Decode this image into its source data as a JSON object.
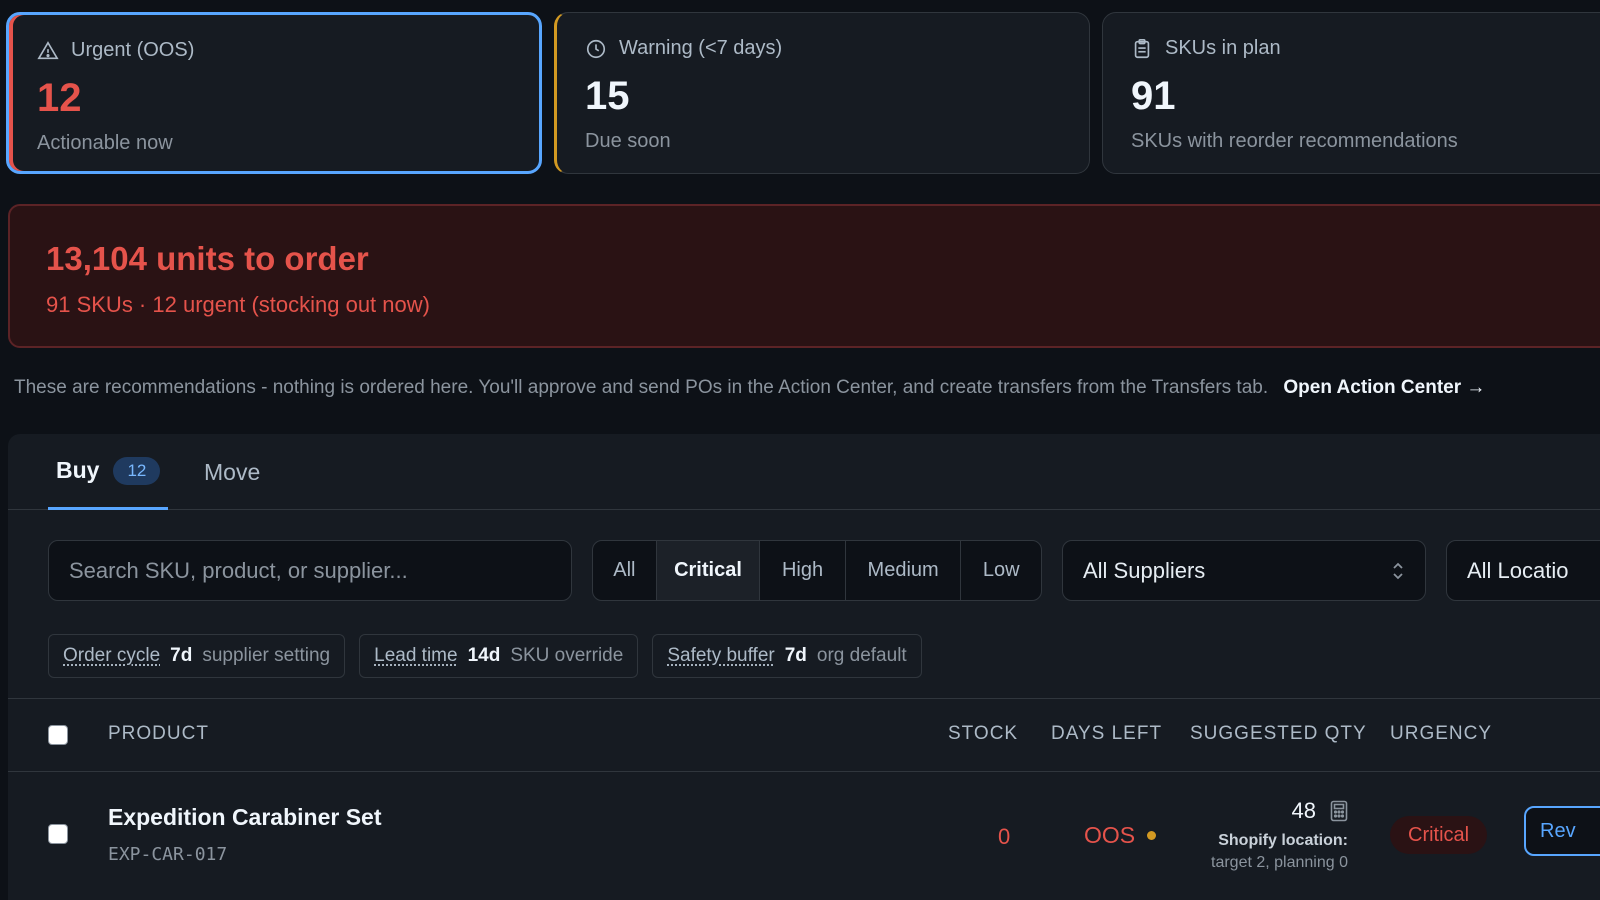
{
  "cards": [
    {
      "title": "Urgent (OOS)",
      "value": "12",
      "subtitle": "Actionable now",
      "icon": "warning-triangle-icon"
    },
    {
      "title": "Warning (<7 days)",
      "value": "15",
      "subtitle": "Due soon",
      "icon": "clock-icon"
    },
    {
      "title": "SKUs in plan",
      "value": "91",
      "subtitle": "SKUs with reorder recommendations",
      "icon": "clipboard-icon"
    }
  ],
  "banner": {
    "title": "13,104 units to order",
    "subtitle": "91 SKUs · 12 urgent (stocking out now)"
  },
  "notice": {
    "text": "These are recommendations - nothing is ordered here. You'll approve and send POs in the Action Center, and create transfers from the Transfers tab.",
    "link": "Open Action Center →"
  },
  "tabs": [
    {
      "label": "Buy",
      "badge": "12",
      "active": true
    },
    {
      "label": "Move"
    }
  ],
  "filters": {
    "search_placeholder": "Search SKU, product, or supplier...",
    "urgency_options": [
      "All",
      "Critical",
      "High",
      "Medium",
      "Low"
    ],
    "urgency_selected": "Critical",
    "supplier_select": "All Suppliers",
    "location_select": "All Locatio"
  },
  "params": [
    {
      "label": "Order cycle",
      "value": "7d",
      "source": "supplier setting"
    },
    {
      "label": "Lead time",
      "value": "14d",
      "source": "SKU override"
    },
    {
      "label": "Safety buffer",
      "value": "7d",
      "source": "org default"
    }
  ],
  "table": {
    "headers": {
      "product": "PRODUCT",
      "stock": "STOCK",
      "days_left": "DAYS LEFT",
      "suggested_qty": "SUGGESTED QTY",
      "urgency": "URGENCY"
    },
    "rows": [
      {
        "name": "Expedition Carabiner Set",
        "sku": "EXP-CAR-017",
        "stock": "0",
        "days_left": "OOS",
        "suggested_qty": "48",
        "qty_note_1": "Shopify location:",
        "qty_note_2": "target 2, planning 0",
        "urgency": "Critical",
        "action": "Rev"
      }
    ]
  },
  "colors": {
    "background": "#0d1117",
    "surface": "#161b22",
    "accent": "#58a6ff",
    "critical": "#e5534b",
    "warning": "#d29922"
  }
}
